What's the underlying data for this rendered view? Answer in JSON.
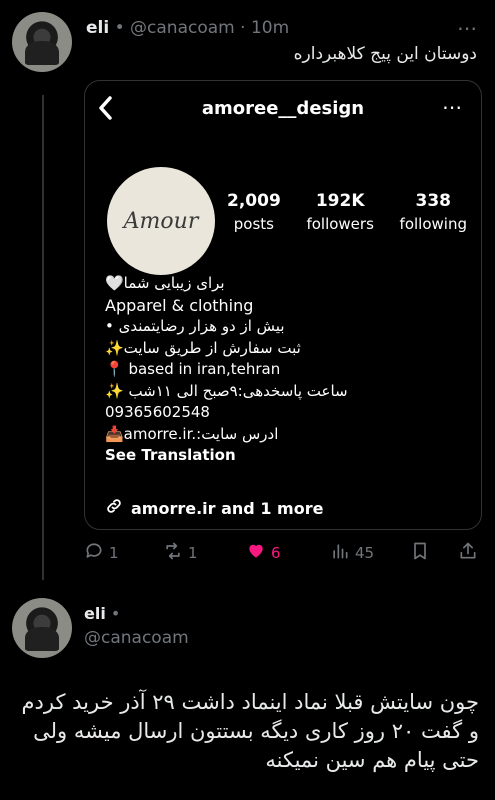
{
  "tweet1": {
    "author_name": "eli",
    "author_sep": "•",
    "author_handle": "@canacoam",
    "time": "10m",
    "time_sep": "·",
    "more": "⋯",
    "text": "دوستان این پیج کلاهبرداره"
  },
  "instagram": {
    "back_icon": "chevron-left-icon",
    "username": "amoree__design",
    "more": "⋯",
    "logo_text": "Amour",
    "stats": [
      {
        "value": "2,009",
        "label": "posts"
      },
      {
        "value": "192K",
        "label": "followers"
      },
      {
        "value": "338",
        "label": "following"
      }
    ],
    "bio": {
      "line1": "برای زیبایی شما🤍",
      "category": "Apparel & clothing",
      "line3": "بیش از دو هزار رضایتمندی •",
      "line4": "ثبت سفارش از طریق سایت✨",
      "line5": "📍 based in iran,tehran",
      "line6": "ساعت پاسخدهی:۹صبح الی ۱۱شب ✨",
      "line7": "09365602548",
      "line8": "📥amorre.ir.:ادرس سایت",
      "see_translation": "See Translation"
    },
    "link": "amorre.ir and 1 more"
  },
  "actions": {
    "replies": "1",
    "retweets": "1",
    "likes": "6",
    "views": "45",
    "like_color": "#f91880"
  },
  "tweet2": {
    "author_name": "eli",
    "author_sep": "•",
    "author_handle": "@canacoam",
    "text": "چون سایتش قبلا نماد اینماد داشت ۲۹ آذر خرید کردم و گفت ۲۰ روز کاری دیگه بستتون ارسال میشه ولی حتی پیام هم سین نمیکنه"
  }
}
